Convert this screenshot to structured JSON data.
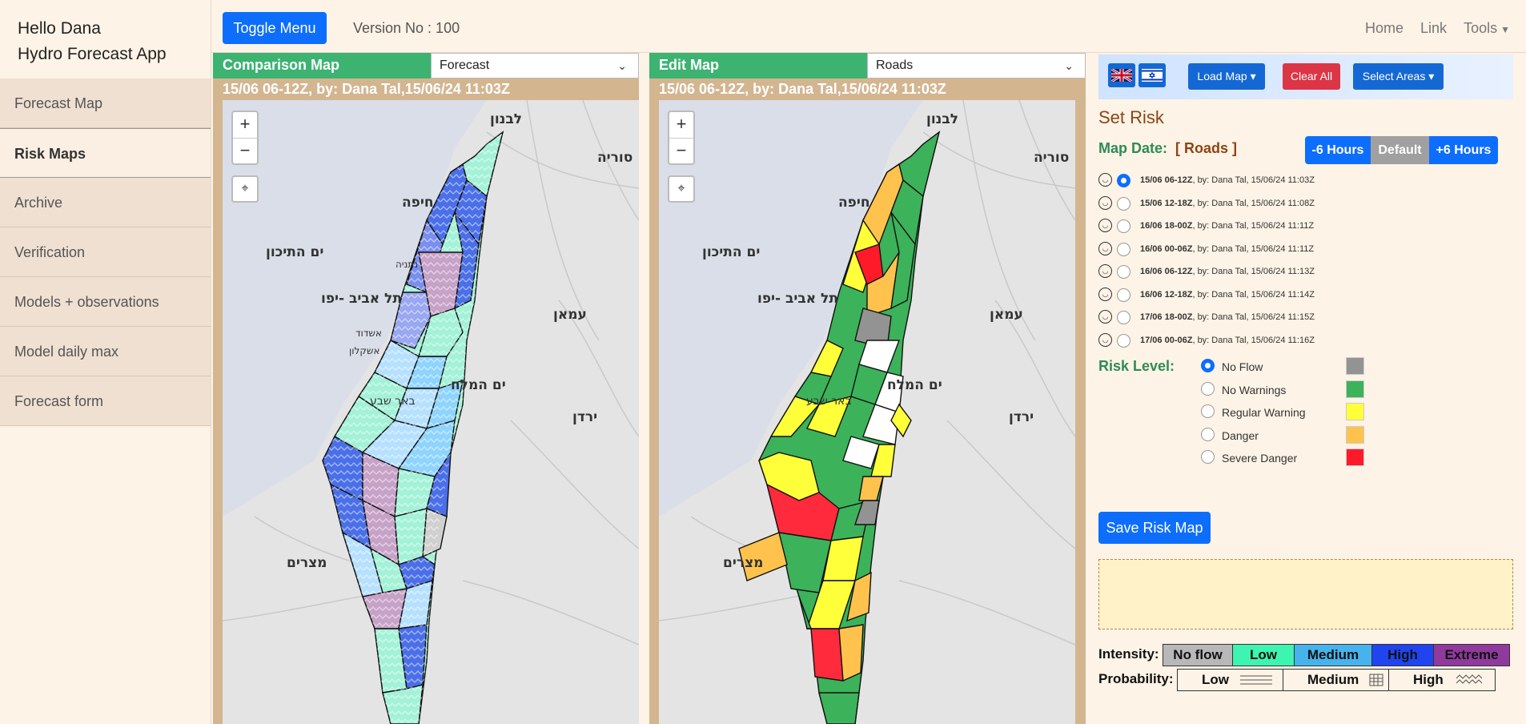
{
  "sidebar": {
    "greeting_line1": "Hello Dana",
    "greeting_line2": "Hydro Forecast App",
    "items": [
      {
        "label": "Forecast Map"
      },
      {
        "label": "Risk Maps"
      },
      {
        "label": "Archive"
      },
      {
        "label": "Verification"
      },
      {
        "label": "Models + observations"
      },
      {
        "label": "Model daily max"
      },
      {
        "label": "Forecast form"
      }
    ]
  },
  "topbar": {
    "toggle_label": "Toggle Menu",
    "version": "Version No : 100",
    "nav": [
      "Home",
      "Link",
      "Tools"
    ]
  },
  "comparison": {
    "title": "Comparison Map",
    "selected": "Forecast",
    "subtitle": "15/06 06-12Z, by: Dana Tal,15/06/24 11:03Z"
  },
  "edit": {
    "title": "Edit Map",
    "selected": "Roads",
    "subtitle": "15/06 06-12Z, by: Dana Tal,15/06/24 11:03Z"
  },
  "map_controls": {
    "zoom_in": "+",
    "zoom_out": "−",
    "locate": "⌖"
  },
  "map_labels": {
    "lebanon": "לבנון",
    "syria": "סוריה",
    "haifa": "חיפה",
    "sea": "ים התיכון",
    "telaviv": "תל אביב -יפו",
    "amman": "עמאן",
    "deadsea": "ים המלח",
    "beersheva": "באר שבע",
    "jordan": "ירדן",
    "egypt": "מצרים",
    "netanya": "נתניה",
    "ashdod": "אשדוד",
    "ashkelon": "אשקלון"
  },
  "controls": {
    "load_map": "Load Map ▾",
    "clear_all": "Clear All",
    "select_areas": "Select Areas ▾",
    "set_risk": "Set Risk",
    "map_date_label": "Map Date:",
    "map_date_value": "[ Roads ]",
    "minus6": "-6 Hours",
    "default": "Default",
    "plus6": "+6 Hours",
    "risk_level_label": "Risk Level:",
    "save_label": "Save Risk Map",
    "intensity_label": "Intensity:",
    "probability_label": "Probability:"
  },
  "maps": [
    {
      "date": "15/06",
      "range": "06-12Z",
      "by": ", by: Dana Tal, 15/06/24 11:03Z",
      "checked": true
    },
    {
      "date": "15/06",
      "range": "12-18Z",
      "by": ", by: Dana Tal, 15/06/24 11:08Z",
      "checked": false
    },
    {
      "date": "16/06",
      "range": "18-00Z",
      "by": ", by: Dana Tal, 15/06/24 11:11Z",
      "checked": false
    },
    {
      "date": "16/06",
      "range": "00-06Z",
      "by": ", by: Dana Tal, 15/06/24 11:11Z",
      "checked": false
    },
    {
      "date": "16/06",
      "range": "06-12Z",
      "by": ", by: Dana Tal, 15/06/24 11:13Z",
      "checked": false
    },
    {
      "date": "16/06",
      "range": "12-18Z",
      "by": ", by: Dana Tal, 15/06/24 11:14Z",
      "checked": false
    },
    {
      "date": "17/06",
      "range": "18-00Z",
      "by": ", by: Dana Tal, 15/06/24 11:15Z",
      "checked": false
    },
    {
      "date": "17/06",
      "range": "00-06Z",
      "by": ", by: Dana Tal, 15/06/24 11:16Z",
      "checked": false
    }
  ],
  "risk_levels": [
    {
      "label": "No Flow",
      "color": "#939393",
      "checked": true
    },
    {
      "label": "No Warnings",
      "color": "#3cb25a",
      "checked": false
    },
    {
      "label": "Regular Warning",
      "color": "#ffff3a",
      "checked": false
    },
    {
      "label": "Danger",
      "color": "#ffc34d",
      "checked": false
    },
    {
      "label": "Severe Danger",
      "color": "#ff1a2a",
      "checked": false
    }
  ],
  "intensity": [
    {
      "label": "No flow",
      "color": "#b8b8b8"
    },
    {
      "label": "Low",
      "color": "#3df5b0"
    },
    {
      "label": "Medium",
      "color": "#46b3ec"
    },
    {
      "label": "High",
      "color": "#1f44f0"
    },
    {
      "label": "Extreme",
      "color": "#8f3a9c"
    }
  ],
  "probability": [
    {
      "label": "Low"
    },
    {
      "label": "Medium"
    },
    {
      "label": "High"
    }
  ]
}
